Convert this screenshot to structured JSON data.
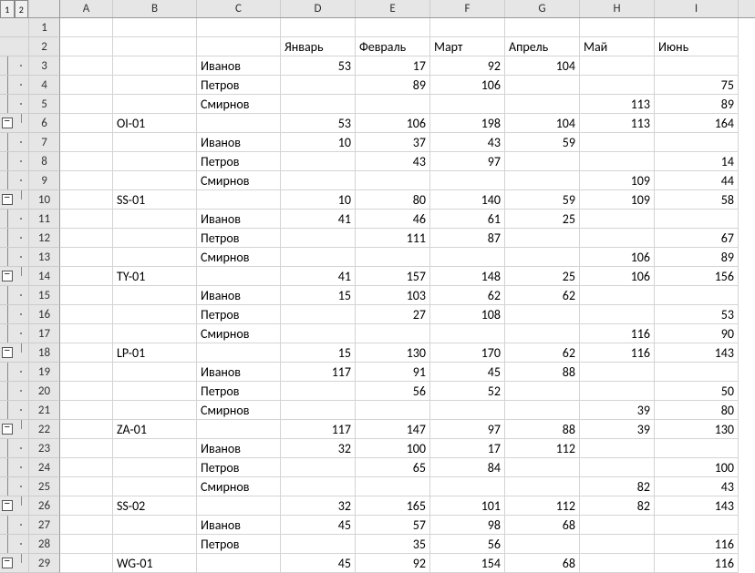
{
  "outline_levels": [
    "1",
    "2"
  ],
  "columns": [
    "A",
    "B",
    "C",
    "D",
    "E",
    "F",
    "G",
    "H",
    "I"
  ],
  "headers": {
    "D": "Январь",
    "E": "Февраль",
    "F": "Март",
    "G": "Апрель",
    "H": "Май",
    "I": "Июнь"
  },
  "rows": [
    {
      "n": 1,
      "outline": "",
      "B": "",
      "C": "",
      "D": "",
      "E": "",
      "F": "",
      "G": "",
      "H": "",
      "I": ""
    },
    {
      "n": 2,
      "outline": "",
      "B": "",
      "C": "",
      "D": "Январь",
      "E": "Февраль",
      "F": "Март",
      "G": "Апрель",
      "H": "Май",
      "I": "Июнь"
    },
    {
      "n": 3,
      "outline": "dot",
      "B": "",
      "C": "Иванов",
      "D": "53",
      "E": "17",
      "F": "92",
      "G": "104",
      "H": "",
      "I": ""
    },
    {
      "n": 4,
      "outline": "dot",
      "B": "",
      "C": "Петров",
      "D": "",
      "E": "89",
      "F": "106",
      "G": "",
      "H": "",
      "I": "75"
    },
    {
      "n": 5,
      "outline": "dot",
      "B": "",
      "C": "Смирнов",
      "D": "",
      "E": "",
      "F": "",
      "G": "",
      "H": "113",
      "I": "89"
    },
    {
      "n": 6,
      "outline": "minus",
      "B": "OI-01",
      "C": "",
      "D": "53",
      "E": "106",
      "F": "198",
      "G": "104",
      "H": "113",
      "I": "164"
    },
    {
      "n": 7,
      "outline": "dot",
      "B": "",
      "C": "Иванов",
      "D": "10",
      "E": "37",
      "F": "43",
      "G": "59",
      "H": "",
      "I": ""
    },
    {
      "n": 8,
      "outline": "dot",
      "B": "",
      "C": "Петров",
      "D": "",
      "E": "43",
      "F": "97",
      "G": "",
      "H": "",
      "I": "14"
    },
    {
      "n": 9,
      "outline": "dot",
      "B": "",
      "C": "Смирнов",
      "D": "",
      "E": "",
      "F": "",
      "G": "",
      "H": "109",
      "I": "44"
    },
    {
      "n": 10,
      "outline": "minus",
      "B": "SS-01",
      "C": "",
      "D": "10",
      "E": "80",
      "F": "140",
      "G": "59",
      "H": "109",
      "I": "58"
    },
    {
      "n": 11,
      "outline": "dot",
      "B": "",
      "C": "Иванов",
      "D": "41",
      "E": "46",
      "F": "61",
      "G": "25",
      "H": "",
      "I": ""
    },
    {
      "n": 12,
      "outline": "dot",
      "B": "",
      "C": "Петров",
      "D": "",
      "E": "111",
      "F": "87",
      "G": "",
      "H": "",
      "I": "67"
    },
    {
      "n": 13,
      "outline": "dot",
      "B": "",
      "C": "Смирнов",
      "D": "",
      "E": "",
      "F": "",
      "G": "",
      "H": "106",
      "I": "89"
    },
    {
      "n": 14,
      "outline": "minus",
      "B": "TY-01",
      "C": "",
      "D": "41",
      "E": "157",
      "F": "148",
      "G": "25",
      "H": "106",
      "I": "156"
    },
    {
      "n": 15,
      "outline": "dot",
      "B": "",
      "C": "Иванов",
      "D": "15",
      "E": "103",
      "F": "62",
      "G": "62",
      "H": "",
      "I": ""
    },
    {
      "n": 16,
      "outline": "dot",
      "B": "",
      "C": "Петров",
      "D": "",
      "E": "27",
      "F": "108",
      "G": "",
      "H": "",
      "I": "53"
    },
    {
      "n": 17,
      "outline": "dot",
      "B": "",
      "C": "Смирнов",
      "D": "",
      "E": "",
      "F": "",
      "G": "",
      "H": "116",
      "I": "90"
    },
    {
      "n": 18,
      "outline": "minus",
      "B": "LP-01",
      "C": "",
      "D": "15",
      "E": "130",
      "F": "170",
      "G": "62",
      "H": "116",
      "I": "143"
    },
    {
      "n": 19,
      "outline": "dot",
      "B": "",
      "C": "Иванов",
      "D": "117",
      "E": "91",
      "F": "45",
      "G": "88",
      "H": "",
      "I": ""
    },
    {
      "n": 20,
      "outline": "dot",
      "B": "",
      "C": "Петров",
      "D": "",
      "E": "56",
      "F": "52",
      "G": "",
      "H": "",
      "I": "50"
    },
    {
      "n": 21,
      "outline": "dot",
      "B": "",
      "C": "Смирнов",
      "D": "",
      "E": "",
      "F": "",
      "G": "",
      "H": "39",
      "I": "80"
    },
    {
      "n": 22,
      "outline": "minus",
      "B": "ZA-01",
      "C": "",
      "D": "117",
      "E": "147",
      "F": "97",
      "G": "88",
      "H": "39",
      "I": "130"
    },
    {
      "n": 23,
      "outline": "dot",
      "B": "",
      "C": "Иванов",
      "D": "32",
      "E": "100",
      "F": "17",
      "G": "112",
      "H": "",
      "I": ""
    },
    {
      "n": 24,
      "outline": "dot",
      "B": "",
      "C": "Петров",
      "D": "",
      "E": "65",
      "F": "84",
      "G": "",
      "H": "",
      "I": "100"
    },
    {
      "n": 25,
      "outline": "dot",
      "B": "",
      "C": "Смирнов",
      "D": "",
      "E": "",
      "F": "",
      "G": "",
      "H": "82",
      "I": "43"
    },
    {
      "n": 26,
      "outline": "minus",
      "B": "SS-02",
      "C": "",
      "D": "32",
      "E": "165",
      "F": "101",
      "G": "112",
      "H": "82",
      "I": "143"
    },
    {
      "n": 27,
      "outline": "dot",
      "B": "",
      "C": "Иванов",
      "D": "45",
      "E": "57",
      "F": "98",
      "G": "68",
      "H": "",
      "I": ""
    },
    {
      "n": 28,
      "outline": "dot",
      "B": "",
      "C": "Петров",
      "D": "",
      "E": "35",
      "F": "56",
      "G": "",
      "H": "",
      "I": "116"
    },
    {
      "n": 29,
      "outline": "minus",
      "B": "WG-01",
      "C": "",
      "D": "45",
      "E": "92",
      "F": "154",
      "G": "68",
      "H": "",
      "I": "116"
    }
  ]
}
